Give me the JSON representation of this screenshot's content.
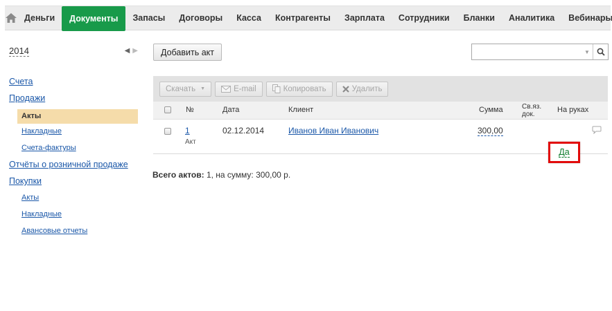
{
  "nav": {
    "items": [
      {
        "label": "Деньги"
      },
      {
        "label": "Документы",
        "active": true
      },
      {
        "label": "Запасы"
      },
      {
        "label": "Договоры"
      },
      {
        "label": "Касса"
      },
      {
        "label": "Контрагенты"
      },
      {
        "label": "Зарплата"
      },
      {
        "label": "Сотрудники"
      },
      {
        "label": "Бланки"
      },
      {
        "label": "Аналитика"
      },
      {
        "label": "Вебинары"
      }
    ],
    "active_color": "#189a4a",
    "home_icon": "home-icon"
  },
  "sidebar": {
    "year": "2014",
    "items": [
      {
        "label": "Счета",
        "level": 1
      },
      {
        "label": "Продажи",
        "level": 1
      },
      {
        "label": "Акты",
        "level": 2,
        "active": true
      },
      {
        "label": "Накладные",
        "level": 2
      },
      {
        "label": "Счета-фактуры",
        "level": 2
      },
      {
        "label": "Отчёты о розничной продаже",
        "level": 1
      },
      {
        "label": "Покупки",
        "level": 1
      },
      {
        "label": "Акты",
        "level": 2
      },
      {
        "label": "Накладные",
        "level": 2
      },
      {
        "label": "Авансовые отчеты",
        "level": 2
      }
    ],
    "active_bg": "#f5dcaa"
  },
  "actions": {
    "add_label": "Добавить акт",
    "search_value": ""
  },
  "toolbar": {
    "download": "Скачать",
    "email": "E-mail",
    "copy": "Копировать",
    "delete": "Удалить"
  },
  "table": {
    "headers": {
      "num": "№",
      "date": "Дата",
      "client": "Клиент",
      "sum": "Сумма",
      "linked_1": "Св.яз.",
      "linked_2": "док.",
      "handed": "На руках"
    },
    "rows": [
      {
        "num": "1",
        "type": "Акт",
        "date": "02.12.2014",
        "client": "Иванов Иван Иванович",
        "sum": "300,00",
        "handed": "Да"
      }
    ]
  },
  "summary": {
    "label": "Всего актов:",
    "text": " 1, на сумму: 300,00 р."
  },
  "colors": {
    "link": "#1a57a8",
    "highlight_border": "#e20a0a",
    "handed_text": "#0b7a2a"
  }
}
